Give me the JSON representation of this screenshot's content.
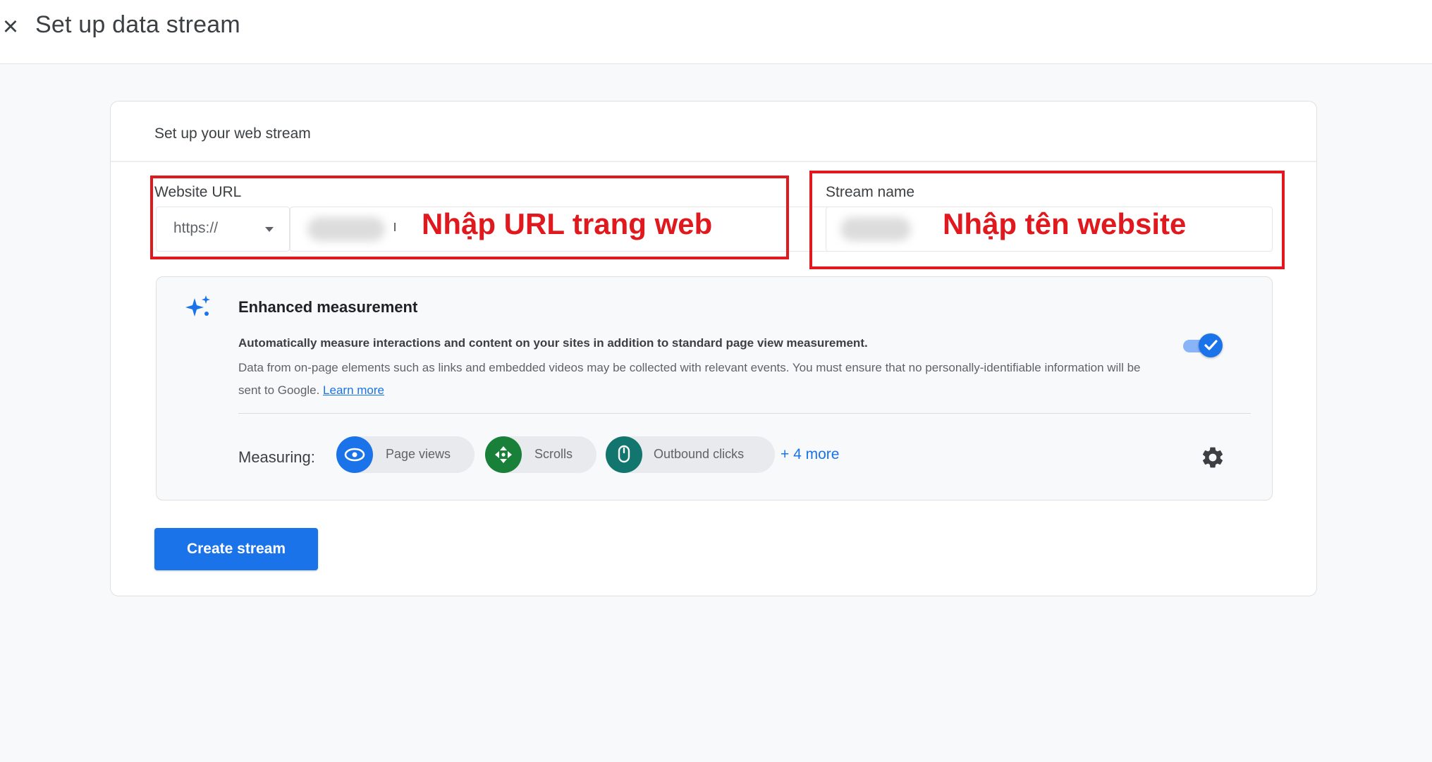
{
  "header": {
    "close_icon": "close-icon",
    "title": "Set up data stream"
  },
  "form": {
    "title": "Set up your web stream",
    "website_url": {
      "label": "Website URL",
      "protocol_value": "https://",
      "value_tail": "ı"
    },
    "stream_name": {
      "label": "Stream name"
    },
    "annotations": {
      "url_hint": "Nhập URL trang web",
      "name_hint": "Nhập tên website",
      "color": "#e0191f"
    }
  },
  "enhanced_measurement": {
    "icon": "sparkle-icon",
    "title": "Enhanced measurement",
    "description_bold": "Automatically measure interactions and content on your sites in addition to standard page view measurement.",
    "description": "Data from on-page elements such as links and embedded videos may be collected with relevant events. You must ensure that no personally-identifiable information will be sent to Google.",
    "learn_more": "Learn more",
    "toggle_on": true,
    "measuring_label": "Measuring:",
    "chips": [
      {
        "label": "Page views",
        "icon": "eye-icon",
        "color": "#1a73e8"
      },
      {
        "label": "Scrolls",
        "icon": "scroll-icon",
        "color": "#188038"
      },
      {
        "label": "Outbound clicks",
        "icon": "mouse-icon",
        "color": "#12766e"
      }
    ],
    "more_link": "+ 4 more",
    "settings_icon": "gear-icon"
  },
  "actions": {
    "create_button": "Create stream",
    "accent": "#1a73e8"
  }
}
